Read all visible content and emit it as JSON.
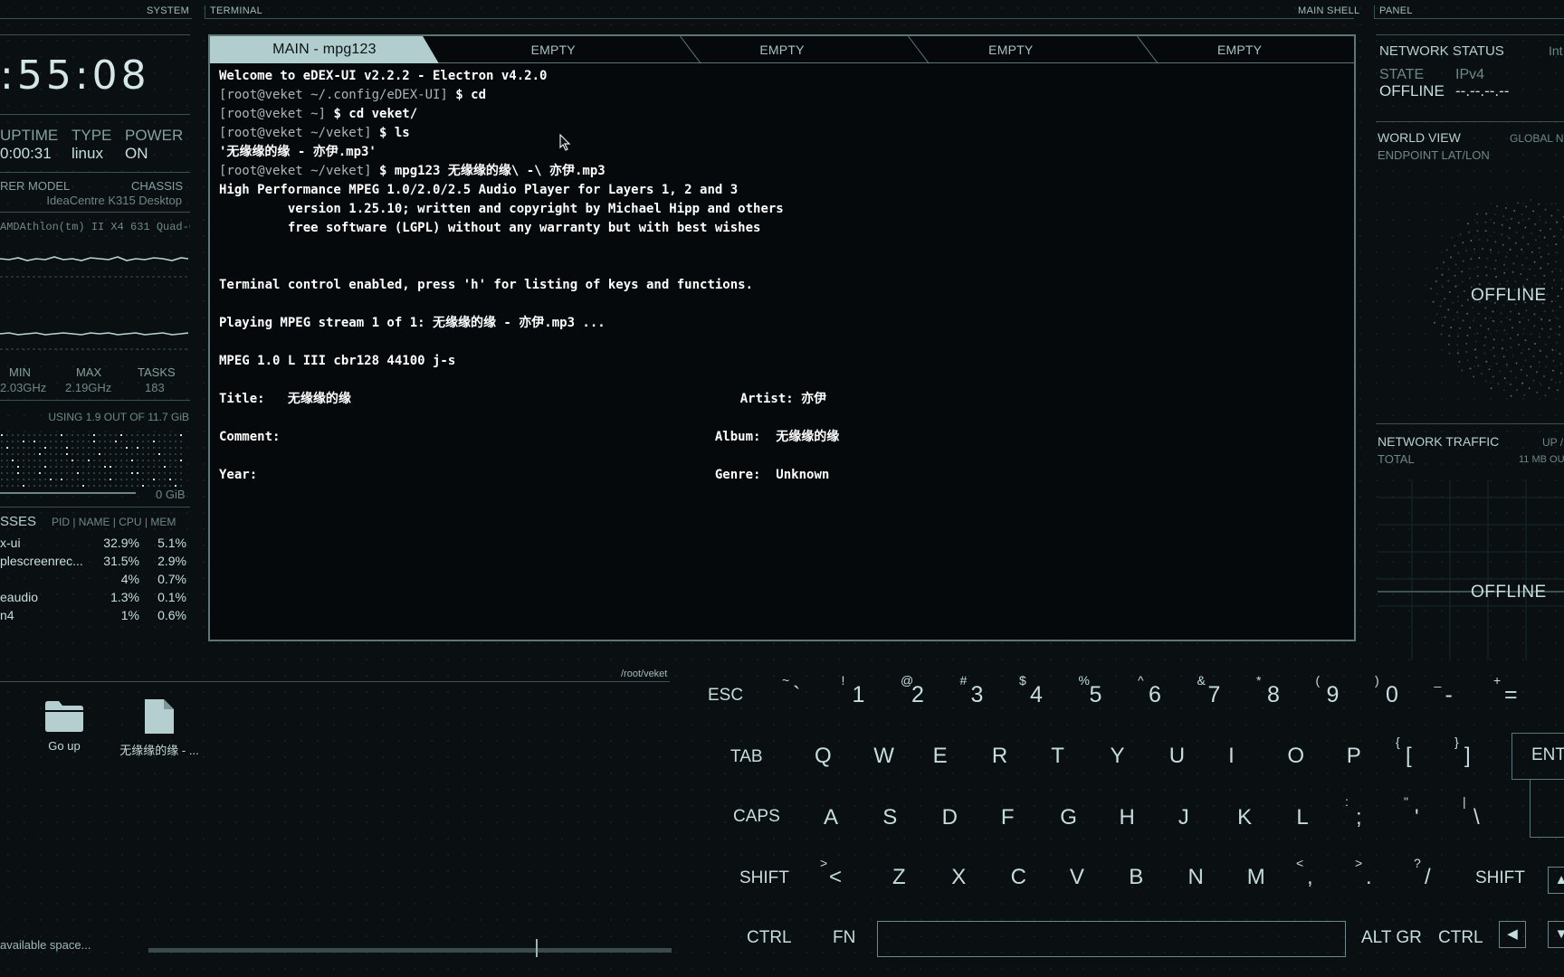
{
  "headers": {
    "system": "SYSTEM",
    "terminal": "TERMINAL",
    "main_shell": "MAIN SHELL",
    "panel": "PANEL"
  },
  "clock": {
    "time": ":55:08"
  },
  "sys": {
    "uptime_label": "UPTIME",
    "uptime": "0:00:31",
    "type_label": "TYPE",
    "type": "linux",
    "power_label": "POWER",
    "power": "ON"
  },
  "hw": {
    "model_label": "RER MODEL",
    "chassis_label": "CHASSIS",
    "chassis": "IdeaCentre K315 Desktop",
    "cpu": "AMDAthlon(tm) II X4 631 Quad-C"
  },
  "cpu": {
    "min_label": "MIN",
    "min": "2.03GHz",
    "max_label": "MAX",
    "max": "2.19GHz",
    "tasks_label": "TASKS",
    "tasks": "183"
  },
  "ram": {
    "usage": "USING 1.9 OUT OF 11.7 GiB",
    "swap": "0 GiB"
  },
  "processes": {
    "title": "SSES",
    "columns": "PID | NAME | CPU | MEM",
    "rows": [
      {
        "name": "x-ui",
        "cpu": "32.9%",
        "mem": "5.1%"
      },
      {
        "name": "plescreenrec...",
        "cpu": "31.5%",
        "mem": "2.9%"
      },
      {
        "name": "",
        "cpu": "4%",
        "mem": "0.7%"
      },
      {
        "name": "eaudio",
        "cpu": "1.3%",
        "mem": "0.1%"
      },
      {
        "name": "n4",
        "cpu": "1%",
        "mem": "0.6%"
      }
    ]
  },
  "terminal": {
    "tabs": [
      "MAIN - mpg123",
      "EMPTY",
      "EMPTY",
      "EMPTY",
      "EMPTY"
    ],
    "lines": [
      {
        "a": "",
        "b": "Welcome to eDEX-UI v2.2.2 - Electron v4.2.0"
      },
      {
        "a": "[root@veket ~/.config/eDEX-UI]",
        "b": " $ cd"
      },
      {
        "a": "[root@veket ~]",
        "b": " $ cd veket/"
      },
      {
        "a": "[root@veket ~/veket]",
        "b": " $ ls"
      },
      {
        "a": "",
        "b": "'无缘缘的缘 - 亦伊.mp3'"
      },
      {
        "a": "[root@veket ~/veket]",
        "b": " $ mpg123 无缘缘的缘\\ -\\ 亦伊.mp3"
      },
      {
        "a": "",
        "b": "High Performance MPEG 1.0/2.0/2.5 Audio Player for Layers 1, 2 and 3"
      },
      {
        "a": "",
        "b": "         version 1.25.10; written and copyright by Michael Hipp and others"
      },
      {
        "a": "",
        "b": "         free software (LGPL) without any warranty but with best wishes"
      },
      {
        "a": "",
        "b": ""
      },
      {
        "a": "",
        "b": ""
      },
      {
        "a": "",
        "b": "Terminal control enabled, press 'h' for listing of keys and functions."
      },
      {
        "a": "",
        "b": ""
      },
      {
        "a": "",
        "b": "Playing MPEG stream 1 of 1: 无缘缘的缘 - 亦伊.mp3 ..."
      },
      {
        "a": "",
        "b": ""
      },
      {
        "a": "",
        "b": "MPEG 1.0 L III cbr128 44100 j-s"
      },
      {
        "a": "",
        "b": ""
      },
      {
        "a": "",
        "b": "Title:   无缘缘的缘                                                   Artist: 亦伊"
      },
      {
        "a": "",
        "b": ""
      },
      {
        "a": "",
        "b": "Comment:                                                         Album:  无缘缘的缘"
      },
      {
        "a": "",
        "b": ""
      },
      {
        "a": "",
        "b": "Year:                                                            Genre:  Unknown"
      }
    ]
  },
  "network": {
    "status_label": "NETWORK STATUS",
    "iface": "Int",
    "state_label": "STATE",
    "state": "OFFLINE",
    "ipv4_label": "IPv4",
    "ipv4": "--.--.--.--"
  },
  "world": {
    "title": "WORLD VIEW",
    "mode": "GLOBAL N",
    "sub": "ENDPOINT LAT/LON",
    "offline": "OFFLINE"
  },
  "traffic": {
    "title": "NETWORK TRAFFIC",
    "up": "UP /",
    "total_label": "TOTAL",
    "total": "11 MB OU",
    "offline": "OFFLINE"
  },
  "files": {
    "path": "/root/veket",
    "items": [
      {
        "label": "Go up",
        "icon": "folder-icon"
      },
      {
        "label": "无缘缘的缘 - ...",
        "icon": "file-icon"
      }
    ],
    "space": "available space..."
  },
  "keyboard": {
    "esc": "ESC",
    "tab": "TAB",
    "caps": "CAPS",
    "shift": "SHIFT",
    "ctrl": "CTRL",
    "fn": "FN",
    "altgr": "ALT GR",
    "enter": "ENT",
    "row1": [
      [
        "~",
        "`"
      ],
      [
        "!",
        "1"
      ],
      [
        "@",
        "2"
      ],
      [
        "#",
        "3"
      ],
      [
        "$",
        "4"
      ],
      [
        "%",
        "5"
      ],
      [
        "^",
        "6"
      ],
      [
        "&",
        "7"
      ],
      [
        "*",
        "8"
      ],
      [
        "(",
        "9"
      ],
      [
        ")",
        "0"
      ],
      [
        "_",
        "-"
      ],
      [
        "+",
        "="
      ]
    ],
    "row2": [
      "Q",
      "W",
      "E",
      "R",
      "T",
      "Y",
      "U",
      "I",
      "O",
      "P"
    ],
    "row2b": [
      [
        "{",
        "["
      ],
      [
        "}",
        "]"
      ]
    ],
    "row3": [
      "A",
      "S",
      "D",
      "F",
      "G",
      "H",
      "J",
      "K",
      "L"
    ],
    "row3b": [
      [
        ":",
        ";"
      ],
      [
        "\"",
        "'"
      ],
      [
        "|",
        "\\"
      ]
    ],
    "row4": [
      "Z",
      "X",
      "C",
      "V",
      "B",
      "N",
      "M"
    ],
    "row4b": [
      [
        "<",
        ","
      ],
      [
        ">",
        "."
      ],
      [
        "?",
        "/"
      ]
    ],
    "row4a": [
      ">",
      "<"
    ]
  }
}
